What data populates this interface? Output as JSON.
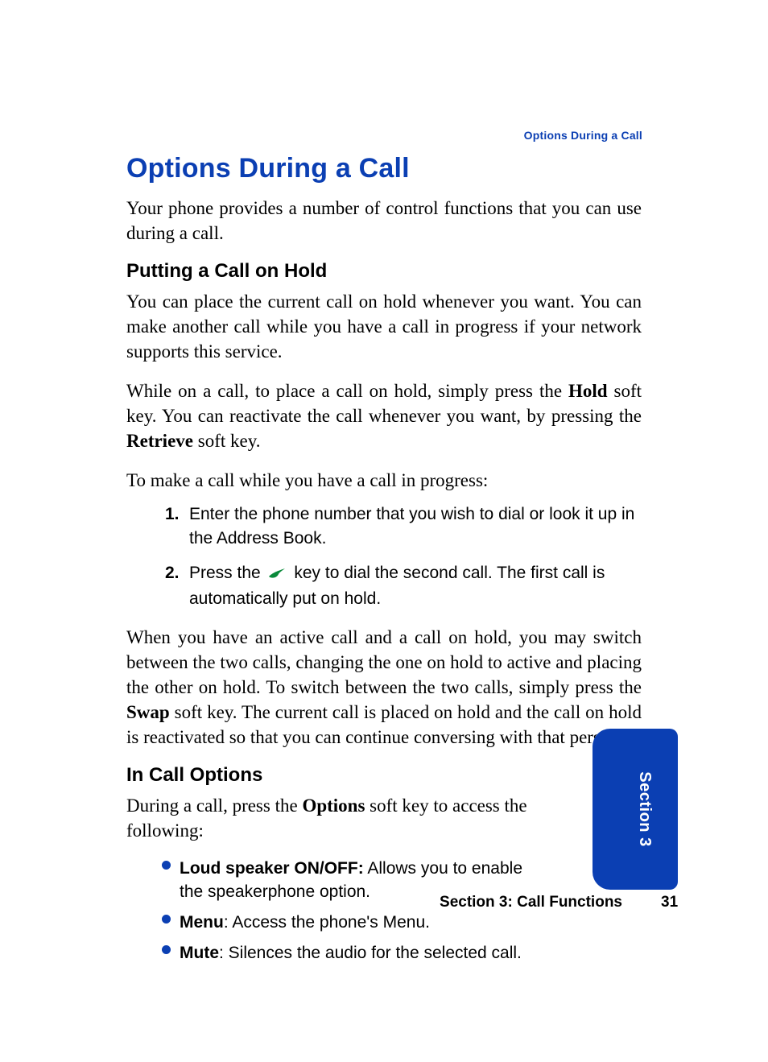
{
  "runningHeader": "Options During a Call",
  "title": "Options During a Call",
  "intro": "Your phone provides a number of control functions that you can use during a call.",
  "hold": {
    "heading": "Putting a Call on Hold",
    "p1": "You can place the current call on hold whenever you want. You can make another call while you have a call in progress if your network supports this service.",
    "p2a": "While on a call, to place a call on hold, simply press the ",
    "p2b": "Hold",
    "p2c": " soft key. You can reactivate the call whenever you want, by pressing the ",
    "p2d": "Retrieve",
    "p2e": " soft key.",
    "p3": "To make a call while you have a call in progress:",
    "steps": {
      "n1": "1.",
      "s1": "Enter the phone number that you wish to dial or look it up in the Address Book.",
      "n2": "2.",
      "s2a": "Press the ",
      "s2b": " key to dial the second call. The first call is automatically put on hold."
    },
    "p4a": "When you have an active call and a call on hold, you may switch between the two calls, changing the one on hold to active and placing the other on hold. To switch between the two calls, simply press the ",
    "p4b": "Swap",
    "p4c": " soft key. The current call is placed on hold and the call on hold is reactivated so that you can continue conversing with that person."
  },
  "inCall": {
    "heading": "In Call Options",
    "introA": "During a call, press the ",
    "introB": "Options",
    "introC": " soft key to access the following:",
    "items": {
      "b1a": "Loud speaker ON/OFF:",
      "b1b": " Allows you to enable the speakerphone option.",
      "b2a": "Menu",
      "b2b": ": Access the phone's Menu.",
      "b3a": "Mute",
      "b3b": ": Silences the audio for the selected call."
    }
  },
  "footer": {
    "label": "Section 3: Call Functions",
    "page": "31"
  },
  "tab": "Section 3"
}
